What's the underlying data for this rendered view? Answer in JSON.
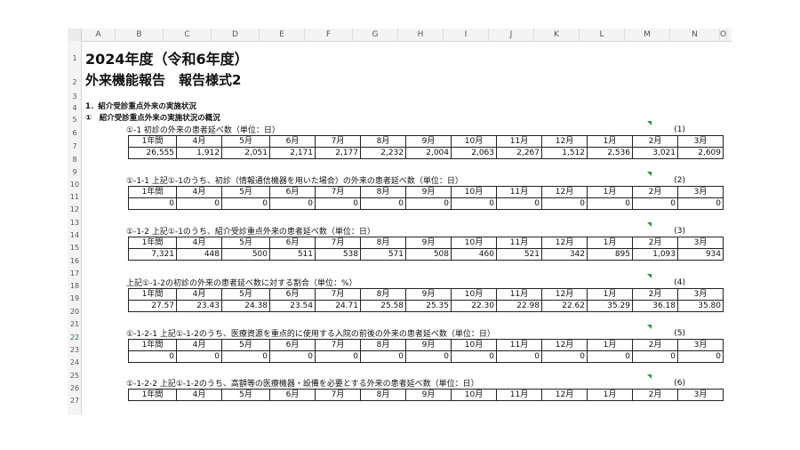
{
  "columns": [
    "A",
    "B",
    "C",
    "D",
    "E",
    "F",
    "G",
    "H",
    "I",
    "J",
    "K",
    "L",
    "M",
    "N",
    "O"
  ],
  "rows": [
    "1",
    "2",
    "3",
    "4",
    "5",
    "6",
    "7",
    "8",
    "9",
    "10",
    "11",
    "12",
    "13",
    "14",
    "15",
    "16",
    "17",
    "18",
    "19",
    "20",
    "21",
    "22",
    "23",
    "24",
    "25",
    "26",
    "27"
  ],
  "selected_row": "22",
  "title1": "2024年度（令和6年度）",
  "title2": "外来機能報告　報告様式2",
  "section1": "1．紹介受診重点外来の実施状況",
  "section2": "①　紹介受診重点外来の実施状況の概況",
  "month_headers": [
    "1年間",
    "4月",
    "5月",
    "6月",
    "7月",
    "8月",
    "9月",
    "10月",
    "11月",
    "12月",
    "1月",
    "2月",
    "3月"
  ],
  "tables": [
    {
      "caption": "①-1 初診の外来の患者延べ数（単位：日）",
      "number": "(1)",
      "values": [
        "26,555",
        "1,912",
        "2,051",
        "2,171",
        "2,177",
        "2,232",
        "2,004",
        "2,063",
        "2,267",
        "1,512",
        "2,536",
        "3,021",
        "2,609"
      ]
    },
    {
      "caption": "①-1-1 上記①-1のうち、初診（情報通信機器を用いた場合）の外来の患者延べ数（単位：日）",
      "number": "(2)",
      "values": [
        "0",
        "0",
        "0",
        "0",
        "0",
        "0",
        "0",
        "0",
        "0",
        "0",
        "0",
        "0",
        "0"
      ]
    },
    {
      "caption": "①-1-2 上記①-1のうち、紹介受診重点外来の患者延べ数（単位：日）",
      "number": "(3)",
      "values": [
        "7,321",
        "448",
        "500",
        "511",
        "538",
        "571",
        "508",
        "460",
        "521",
        "342",
        "895",
        "1,093",
        "934"
      ]
    },
    {
      "caption": "上記①-1-2の初診の外来の患者延べ数に対する割合（単位：%）",
      "number": "(4)",
      "values": [
        "27.57",
        "23.43",
        "24.38",
        "23.54",
        "24.71",
        "25.58",
        "25.35",
        "22.30",
        "22.98",
        "22.62",
        "35.29",
        "36.18",
        "35.80"
      ]
    },
    {
      "caption": "①-1-2-1 上記①-1-2のうち、医療資源を重点的に使用する入院の前後の外来の患者延べ数（単位：日）",
      "number": "(5)",
      "values": [
        "0",
        "0",
        "0",
        "0",
        "0",
        "0",
        "0",
        "0",
        "0",
        "0",
        "0",
        "0",
        "0"
      ]
    },
    {
      "caption": "①-1-2-2 上記①-1-2のうち、高額等の医療機器・設備を必要とする外来の患者延べ数（単位：日）",
      "number": "(6)",
      "values": []
    }
  ]
}
